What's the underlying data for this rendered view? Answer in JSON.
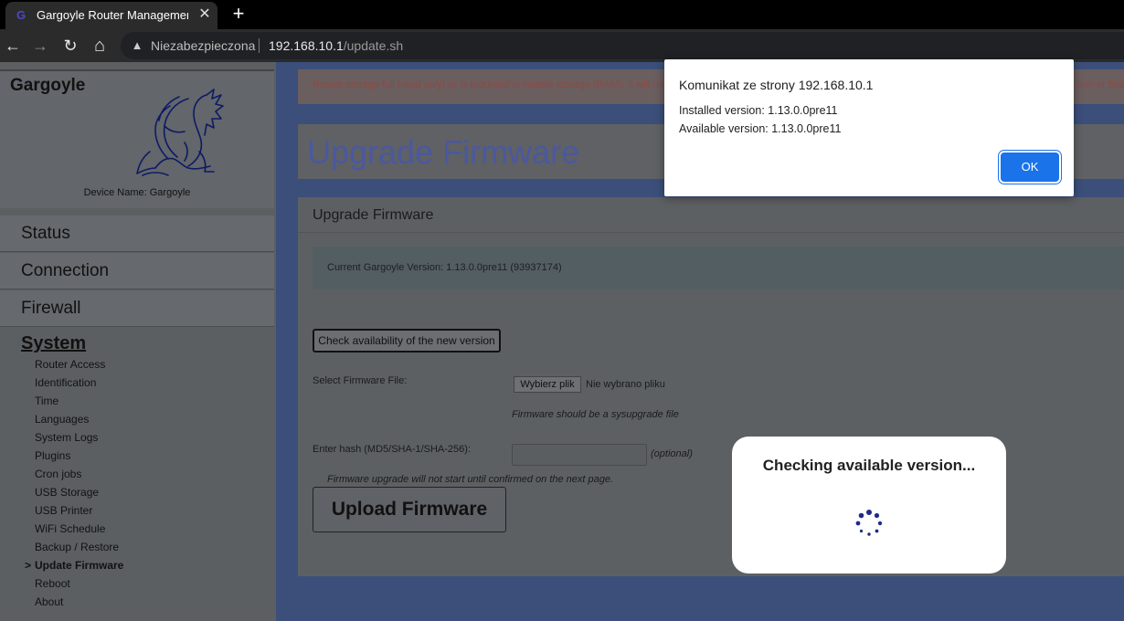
{
  "browser": {
    "tab_title": "Gargoyle Router Management Utility",
    "tab_favicon": "gargoyle-favicon",
    "new_tab": "+",
    "close_tab": "✕",
    "insecure_label": "Niezabezpieczona",
    "url_host": "192.168.10.1",
    "url_path": "/update.sh",
    "back_icon": "←",
    "forward_icon": "→",
    "reload_icon": "↻",
    "home_icon": "⌂"
  },
  "sidebar": {
    "brand": "Gargoyle",
    "device_name": "Device Name: Gargoyle",
    "main_items": [
      "Status",
      "Connection",
      "Firewall"
    ],
    "section": "System",
    "sub_items": [
      "Router Access",
      "Identification",
      "Time",
      "Languages",
      "System Logs",
      "Plugins",
      "Cron jobs",
      "USB Storage",
      "USB Printer",
      "WiFi Schedule",
      "Backup / Restore",
      "Update Firmware",
      "Reboot",
      "About"
    ],
    "active_marker": ">"
  },
  "content": {
    "alert_left": "Router storage full (read only) or is mounted in volatile storage (RAM). It will no",
    "alert_right": "tion or flas",
    "page_title": "Upgrade Firmware",
    "panel_title": "Upgrade Firmware",
    "current_version": "Current Gargoyle Version: 1.13.0.0pre11 (93937174)",
    "check_button": "Check availability of the new version",
    "select_file_label": "Select Firmware File:",
    "file_button": "Wybierz plik",
    "no_file": "Nie wybrano pliku",
    "file_hint": "Firmware should be a sysupgrade file",
    "hash_label": "Enter hash (MD5/SHA-1/SHA-256):",
    "hash_optional": "(optional)",
    "confirm_note": "Firmware upgrade will not start until confirmed on the next page.",
    "upload_button": "Upload Firmware"
  },
  "dialog": {
    "title": "Komunikat ze strony 192.168.10.1",
    "installed": "Installed version: 1.13.0.0pre11",
    "available": "Available version: 1.13.0.0pre11",
    "ok": "OK"
  },
  "loading": {
    "text": "Checking available version...",
    "spinner_icon": "spinner-icon"
  },
  "colors": {
    "accent": "#1a73e8",
    "page_bg": "#3b4f7a",
    "title_text": "#4a58a0"
  }
}
